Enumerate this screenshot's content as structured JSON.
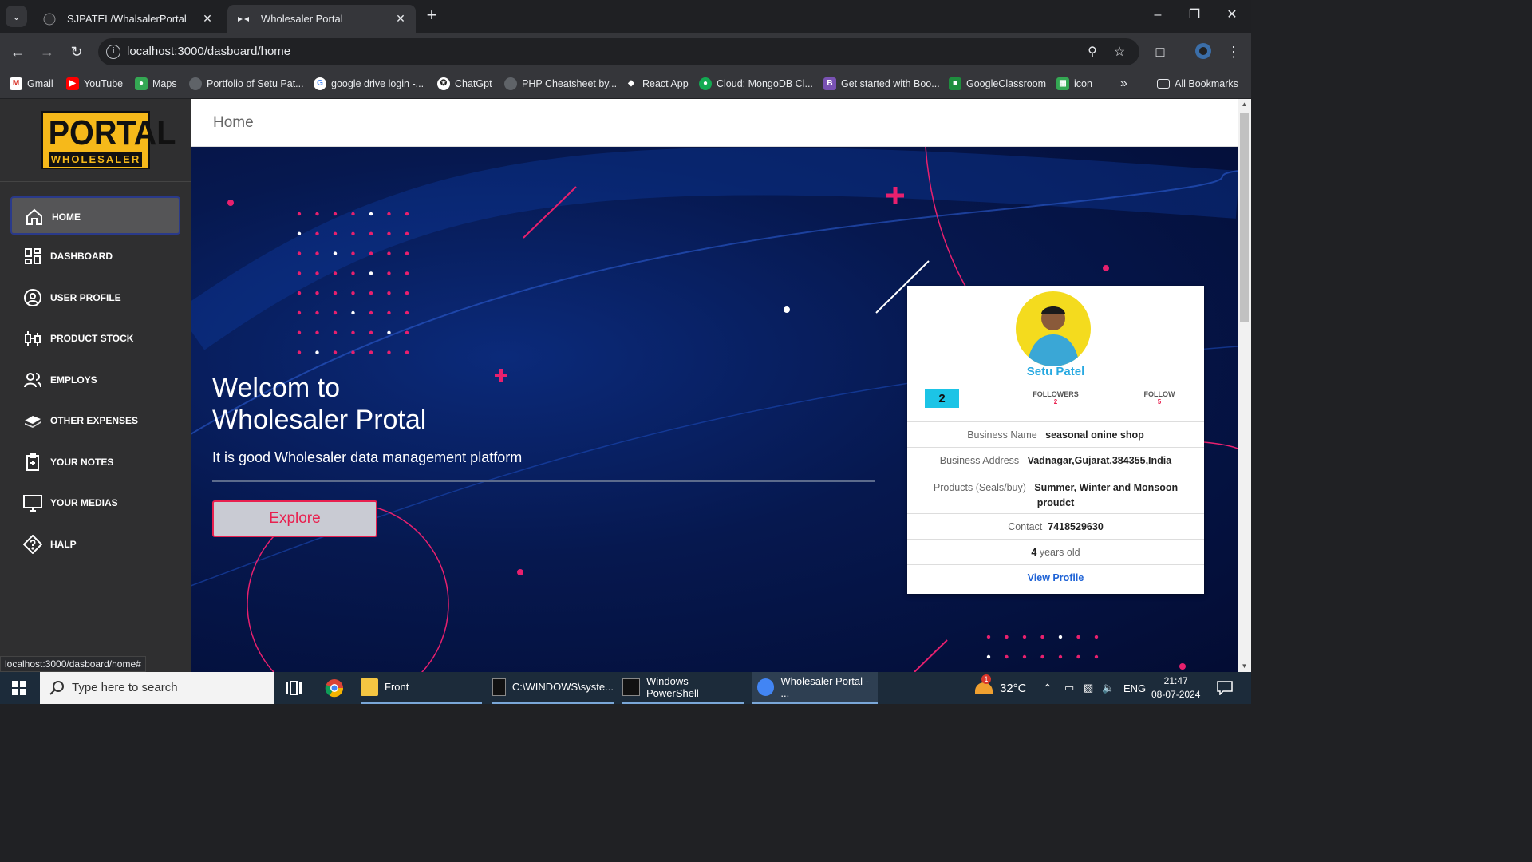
{
  "browser": {
    "tabs": [
      {
        "title": "SJPATEL/WhalsalerPortal"
      },
      {
        "title": "Wholesaler Portal"
      }
    ],
    "url": "localhost:3000/dasboard/home",
    "bookmarks": [
      {
        "label": "Gmail"
      },
      {
        "label": "YouTube"
      },
      {
        "label": "Maps"
      },
      {
        "label": "Portfolio of Setu Pat..."
      },
      {
        "label": "google drive login -..."
      },
      {
        "label": "ChatGpt"
      },
      {
        "label": "PHP Cheatsheet by..."
      },
      {
        "label": "React App"
      },
      {
        "label": "Cloud: MongoDB Cl..."
      },
      {
        "label": "Get started with Boo..."
      },
      {
        "label": "GoogleClassroom"
      },
      {
        "label": "icon"
      }
    ],
    "all_bookmarks": "All Bookmarks",
    "status_url": "localhost:3000/dasboard/home#"
  },
  "sidebar": {
    "logo_big": "PORTAL",
    "logo_small": "WHOLESALER",
    "items": [
      {
        "label": "HOME",
        "icon": "home-icon"
      },
      {
        "label": "DASHBOARD",
        "icon": "dashboard-icon"
      },
      {
        "label": "USER PROFILE",
        "icon": "user-profile-icon"
      },
      {
        "label": "PRODUCT STOCK",
        "icon": "product-stock-icon"
      },
      {
        "label": "EMPLOYS",
        "icon": "employees-icon"
      },
      {
        "label": "OTHER EXPENSES",
        "icon": "money-icon"
      },
      {
        "label": "YOUR NOTES",
        "icon": "notes-icon"
      },
      {
        "label": "YOUR MEDIAS",
        "icon": "monitor-icon"
      },
      {
        "label": "HALP",
        "icon": "help-icon"
      }
    ]
  },
  "header": {
    "title": "Home"
  },
  "hero": {
    "line1": "Welcom to",
    "line2": "Wholesaler Protal",
    "tagline": "It is good Wholesaler data management platform",
    "button": "Explore"
  },
  "profile": {
    "name": "Setu Patel",
    "badge": "2",
    "followers_label": "FOLLOWERS",
    "followers": "2",
    "follow_label": "FOLLOW",
    "follow": "5",
    "business_name_label": "Business Name",
    "business_name": "seasonal onine shop",
    "business_address_label": "Business Address",
    "business_address": "Vadnagar,Gujarat,384355,India",
    "products_label": "Products (Seals/buy)",
    "products_line1": "Summer, Winter and Monsoon",
    "products_line2": "proudct",
    "contact_label": "Contact",
    "contact": "7418529630",
    "age_num": "4",
    "age_text": "years old",
    "view_profile": "View Profile"
  },
  "taskbar": {
    "search_placeholder": "Type here to search",
    "items": [
      {
        "label": "Front"
      },
      {
        "label": "C:\\WINDOWS\\syste..."
      },
      {
        "label": "Windows PowerShell"
      },
      {
        "label": "Wholesaler Portal - ..."
      }
    ],
    "weather_badge": "1",
    "temperature": "32°C",
    "language": "ENG",
    "time": "21:47",
    "date": "08-07-2024"
  }
}
